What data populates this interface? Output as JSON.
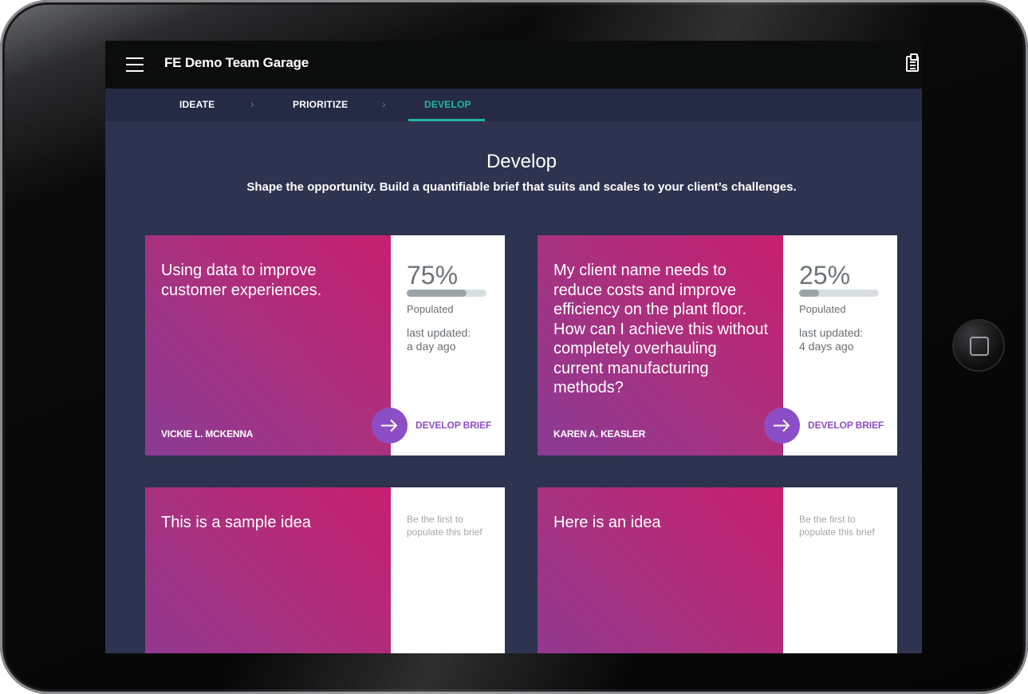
{
  "app": {
    "title": "FE Demo Team Garage"
  },
  "steps": [
    {
      "label": "IDEATE",
      "active": false
    },
    {
      "label": "PRIORITIZE",
      "active": false
    },
    {
      "label": "DEVELOP",
      "active": true
    }
  ],
  "page": {
    "title": "Develop",
    "subtitle": "Shape the opportunity. Build a quantifiable brief that suits and scales to your client’s challenges."
  },
  "cards": [
    {
      "idea": "Using data to improve customer experiences.",
      "author": "VICKIE L. MCKENNA",
      "percent": "75%",
      "progress": 0.75,
      "populated_label": "Populated",
      "updated_label": "last updated:",
      "updated_value": "a day ago",
      "action_label": "DEVELOP BRIEF"
    },
    {
      "idea": "My client name needs to reduce costs and improve efficiency on the plant floor. How can I achieve this without completely overhauling current manufacturing methods?",
      "author": "KAREN A. KEASLER",
      "percent": "25%",
      "progress": 0.25,
      "populated_label": "Populated",
      "updated_label": "last updated:",
      "updated_value": "4 days ago",
      "action_label": "DEVELOP BRIEF"
    },
    {
      "idea": "This is a sample idea",
      "empty_note": "Be the first to populate this brief"
    },
    {
      "idea": "Here is an idea",
      "empty_note": "Be the first to populate this brief"
    }
  ],
  "colors": {
    "accent": "#20b6a2",
    "action": "#8c4ec6",
    "background": "#2e3350",
    "topbar": "#0b0d0d"
  },
  "icons": {
    "menu": "hamburger-menu-icon",
    "clipboard": "clipboard-icon",
    "chevron": "chevron-right-icon",
    "arrow": "arrow-right-icon"
  }
}
